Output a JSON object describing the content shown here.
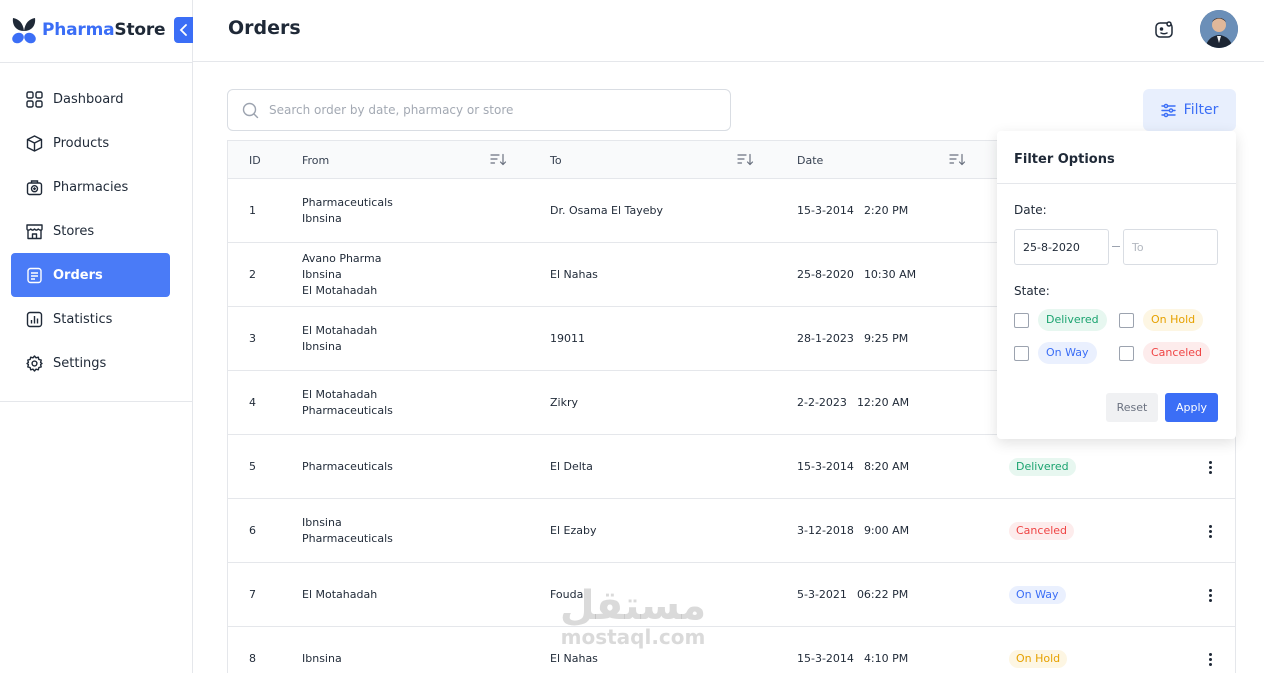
{
  "brand": {
    "name_part1": "Pharma",
    "name_part2": "Store"
  },
  "sidebar": {
    "items": [
      {
        "label": "Dashboard",
        "icon": "grid-icon"
      },
      {
        "label": "Products",
        "icon": "box-icon"
      },
      {
        "label": "Pharmacies",
        "icon": "pharmacy-icon"
      },
      {
        "label": "Stores",
        "icon": "store-icon"
      },
      {
        "label": "Orders",
        "icon": "orders-icon",
        "active": true
      },
      {
        "label": "Statistics",
        "icon": "statistics-icon"
      },
      {
        "label": "Settings",
        "icon": "gear-icon"
      }
    ]
  },
  "header": {
    "title": "Orders"
  },
  "search": {
    "placeholder": "Search order by date, pharmacy or store",
    "value": ""
  },
  "filter_button": {
    "label": "Filter"
  },
  "table": {
    "columns": {
      "id": "ID",
      "from": "From",
      "to": "To",
      "date": "Date"
    },
    "rows": [
      {
        "id": "1",
        "from": [
          "Pharmaceuticals",
          "Ibnsina"
        ],
        "to": "Dr. Osama El Tayeby",
        "date": "15-3-2014",
        "time": "2:20 PM",
        "status": ""
      },
      {
        "id": "2",
        "from": [
          "Avano Pharma",
          "Ibnsina",
          "El Motahadah"
        ],
        "to": "El Nahas",
        "date": "25-8-2020",
        "time": "10:30 AM",
        "status": ""
      },
      {
        "id": "3",
        "from": [
          "El Motahadah",
          "Ibnsina"
        ],
        "to": "19011",
        "date": "28-1-2023",
        "time": "9:25 PM",
        "status": ""
      },
      {
        "id": "4",
        "from": [
          "El Motahadah",
          "Pharmaceuticals"
        ],
        "to": "Zikry",
        "date": "2-2-2023",
        "time": "12:20 AM",
        "status": ""
      },
      {
        "id": "5",
        "from": [
          "Pharmaceuticals"
        ],
        "to": "El Delta",
        "date": "15-3-2014",
        "time": "8:20 AM",
        "status": "Delivered"
      },
      {
        "id": "6",
        "from": [
          "Ibnsina",
          "Pharmaceuticals"
        ],
        "to": "El Ezaby",
        "date": "3-12-2018",
        "time": "9:00 AM",
        "status": "Canceled"
      },
      {
        "id": "7",
        "from": [
          "El Motahadah"
        ],
        "to": "Fouda",
        "date": "5-3-2021",
        "time": "06:22 PM",
        "status": "On Way"
      },
      {
        "id": "8",
        "from": [
          "Ibnsina"
        ],
        "to": "El Nahas",
        "date": "15-3-2014",
        "time": "4:10 PM",
        "status": "On Hold"
      }
    ]
  },
  "filter_popup": {
    "title": "Filter Options",
    "date_label": "Date:",
    "date_from": "25-8-2020",
    "date_to_placeholder": "To",
    "state_label": "State:",
    "states": [
      "Delivered",
      "On Hold",
      "On Way",
      "Canceled"
    ],
    "reset_label": "Reset",
    "apply_label": "Apply"
  },
  "watermark": {
    "arabic": "مستقل",
    "latin": "mostaql.com"
  },
  "colors": {
    "accent": "#3b6ef6",
    "delivered": "#1aa36f",
    "canceled": "#ef4444",
    "on_way": "#3b6ef6",
    "on_hold": "#e6a100"
  }
}
